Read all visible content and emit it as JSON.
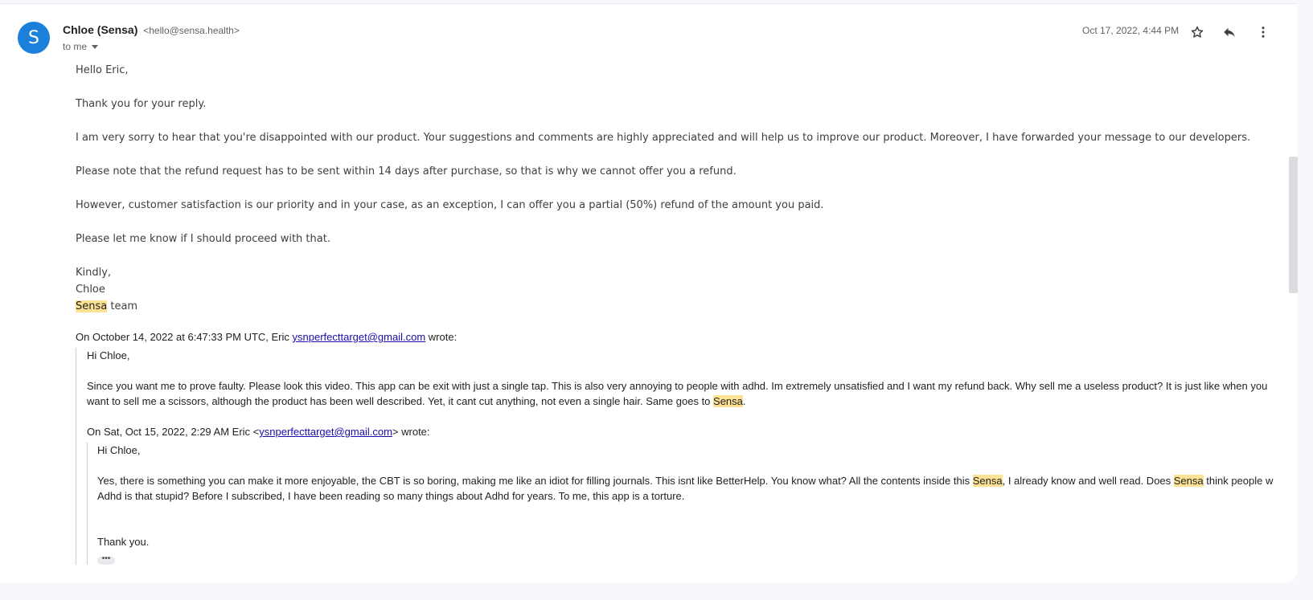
{
  "sender": {
    "avatar_letter": "S",
    "name": "Chloe (Sensa)",
    "email": "<hello@sensa.health>",
    "to": "to me",
    "date": "Oct 17, 2022, 4:44 PM"
  },
  "icons": {
    "star": "star-icon",
    "reply": "reply-icon",
    "more": "more-vert-icon",
    "recipients": "chevron-down-icon"
  },
  "colors": {
    "avatar": "#1a80d9",
    "highlight": "#fde293",
    "link": "#1a0dab"
  },
  "body": {
    "greeting": "Hello Eric,",
    "p1": "Thank you for your reply.",
    "p2": "I am very sorry to hear that you're disappointed with our product. Your suggestions and comments are highly appreciated and will help us to improve our product. Moreover, I have forwarded your message to our developers.",
    "p3": "Please note that the refund request has to be sent within 14 days after purchase, so that is why we cannot offer you a refund.",
    "p4": "However, customer satisfaction is our priority and in your case, as an exception, I can offer you a partial (50%) refund of the amount you paid.",
    "p5": "Please let me know if I should proceed with that.",
    "closing": "Kindly,",
    "signer": "Chloe",
    "sig_brand": "Sensa",
    "sig_team": " team"
  },
  "quote1": {
    "attr_prefix": "On October 14, 2022 at 6:47:33 PM UTC, Eric ",
    "attr_email": "ysnperfecttarget@gmail.com",
    "attr_suffix": " wrote:",
    "greeting": "Hi Chloe,",
    "line1": "Since you want me to prove faulty. Please look this video. This app can be exit with just a single tap. This is also very annoying to people with adhd. Im extremely unsatisfied and I want my refund back. Why sell me a useless product? It is just like when you",
    "line2_prefix": "want to sell me a scissors, although the product has been well described. Yet, it cant cut anything, not even a single hair. Same goes to ",
    "line2_brand": "Sensa",
    "line2_suffix": "."
  },
  "quote2": {
    "attr_prefix": "On Sat, Oct 15, 2022, 2:29 AM Eric <",
    "attr_email": "ysnperfecttarget@gmail.com",
    "attr_suffix": "> wrote:",
    "greeting": "Hi Chloe,",
    "line1_a": "Yes, there is something you can make it more enjoyable, the CBT is so boring, making me like an idiot for filling journals. This isnt like BetterHelp. You know what? All the contents inside this ",
    "line1_brand1": "Sensa",
    "line1_b": ", I already know and well read. Does ",
    "line1_brand2": "Sensa",
    "line1_c": " think people w",
    "line2": "Adhd is that stupid? Before I subscribed, I have been reading so many things about Adhd for years. To me, this app is a torture.",
    "thanks": "Thank you.",
    "trimmed": "•••"
  }
}
